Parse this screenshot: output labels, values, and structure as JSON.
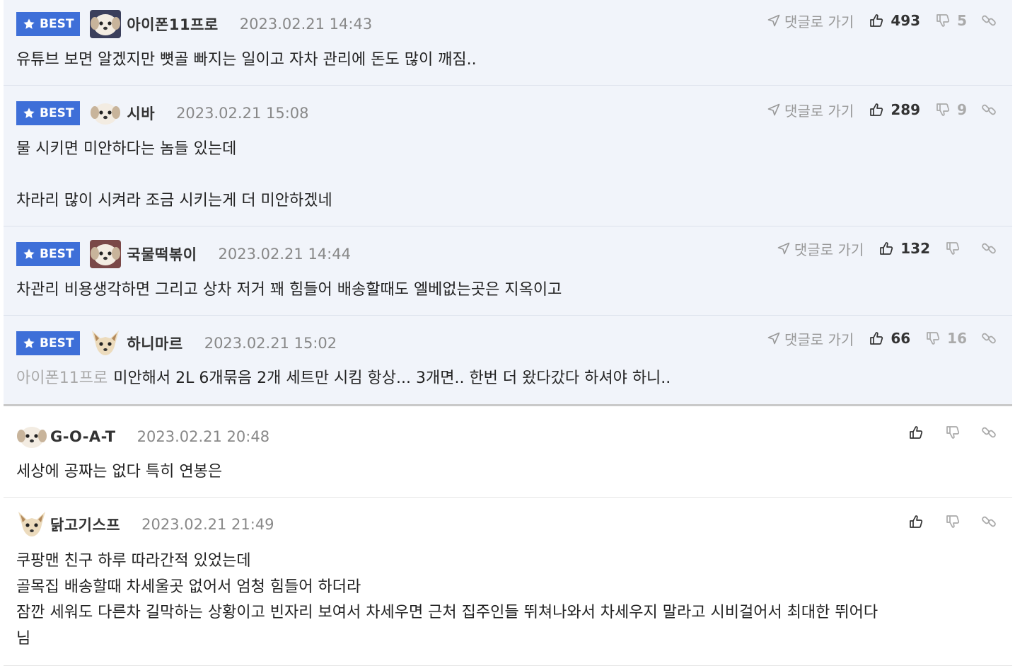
{
  "best_badge": "BEST",
  "goto_label": "댓글로 가기",
  "comments": [
    {
      "nick": "아이폰11프로",
      "date": "2023.02.21 14:43",
      "up": "493",
      "down": "5",
      "lines": [
        "유튜브 보면 알겠지만 뼛골 빠지는 일이고 자차 관리에 돈도 많이 깨짐.."
      ]
    },
    {
      "nick": "시바",
      "date": "2023.02.21 15:08",
      "up": "289",
      "down": "9",
      "lines": [
        "물 시키면 미안하다는 놈들 있는데",
        "",
        "차라리 많이 시켜라 조금 시키는게 더 미안하겠네"
      ]
    },
    {
      "nick": "국물떡볶이",
      "date": "2023.02.21 14:44",
      "up": "132",
      "down": "",
      "lines": [
        "차관리 비용생각하면 그리고 상차 저거 꽤 힘들어 배송할때도 엘베없는곳은 지옥이고"
      ]
    },
    {
      "nick": "하니마르",
      "date": "2023.02.21 15:02",
      "up": "66",
      "down": "16",
      "mention": "아이폰11프로",
      "lines": [
        "미안해서 2L 6개묶음 2개 세트만 시킴 항상... 3개면.. 한번 더 왔다갔다 하셔야 하니.."
      ]
    },
    {
      "nick": "G-O-A-T",
      "date": "2023.02.21 20:48",
      "lines": [
        "세상에 공짜는 없다 특히 연봉은"
      ]
    },
    {
      "nick": "닭고기스프",
      "date": "2023.02.21 21:49",
      "lines": [
        "쿠팡맨 친구 하루 따라간적 있었는데",
        "골목집 배송할때 차세울곳 없어서 엄청 힘들어 하더라",
        "잠깐 세워도 다른차 길막하는 상황이고 빈자리 보여서 차세우면 근처 집주인들 뛰쳐나와서 차세우지 말라고 시비걸어서 최대한 뛰어다",
        "님"
      ]
    }
  ]
}
